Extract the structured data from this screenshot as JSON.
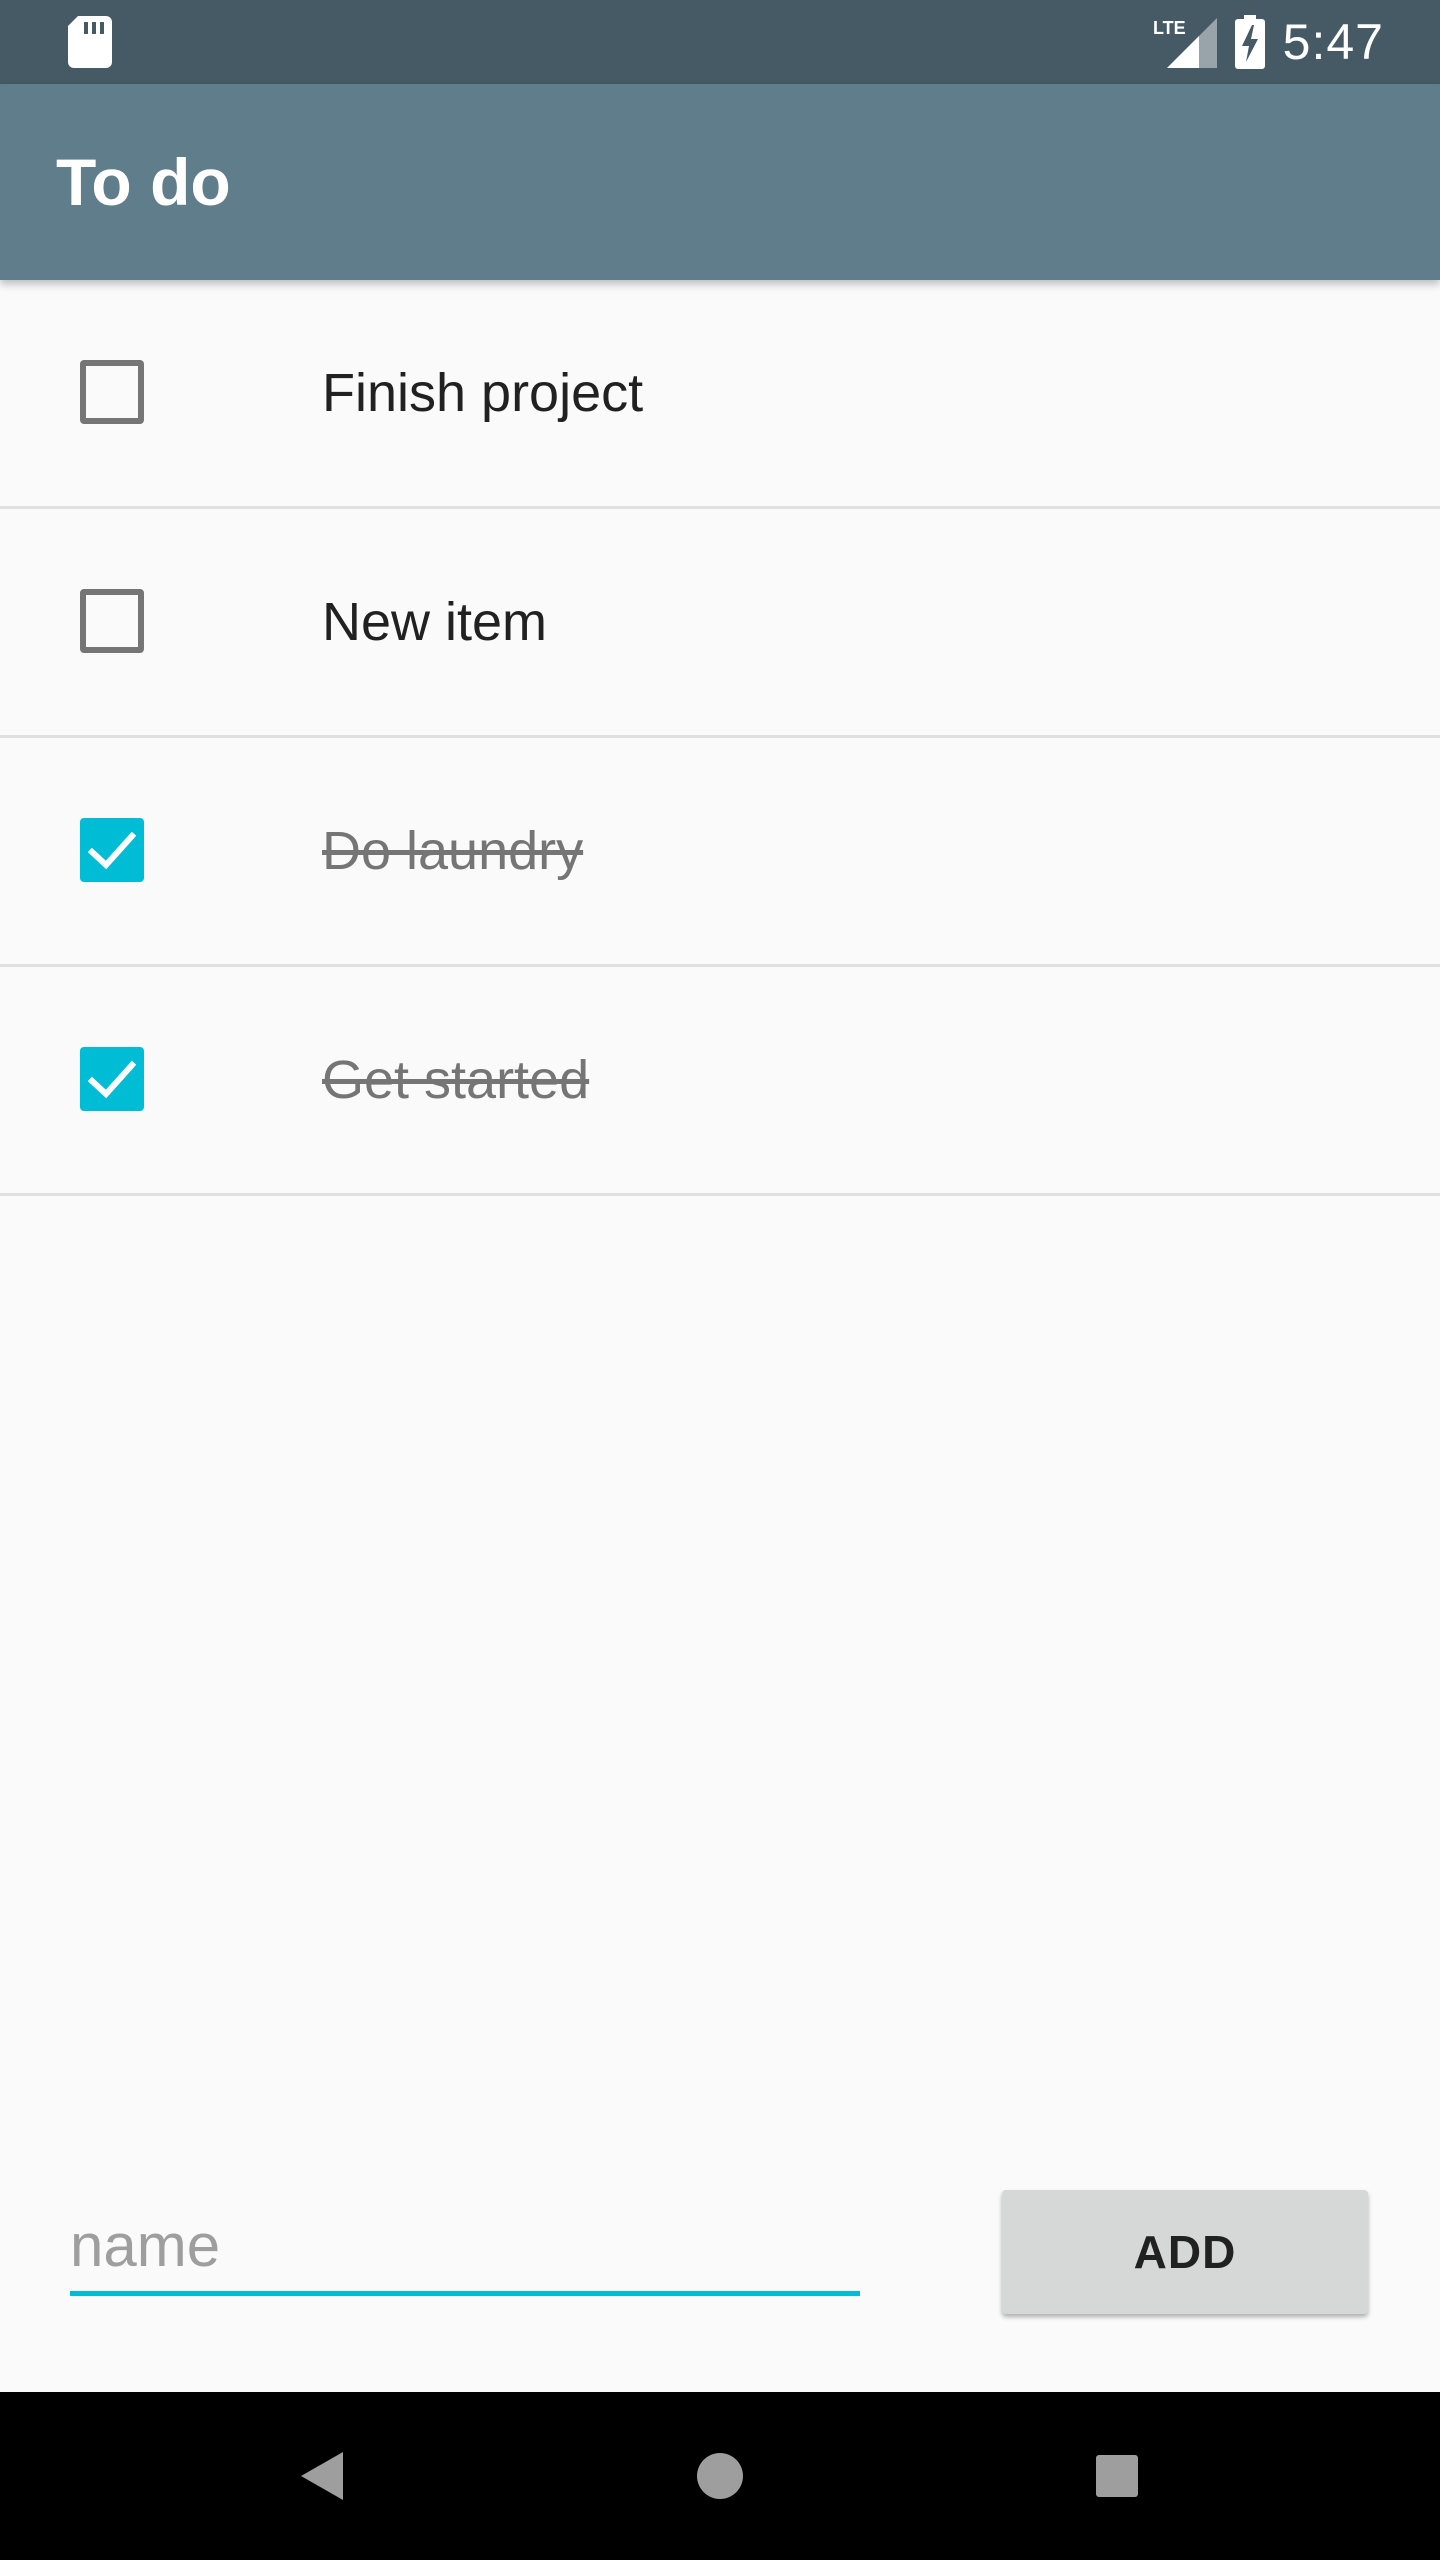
{
  "status_bar": {
    "time": "5:47",
    "network": "LTE",
    "icons": [
      "sd-card-icon",
      "lte-signal-icon",
      "battery-charging-icon"
    ]
  },
  "app_bar": {
    "title": "To do"
  },
  "todos": [
    {
      "label": "Finish project",
      "checked": false
    },
    {
      "label": "New item",
      "checked": false
    },
    {
      "label": "Do laundry",
      "checked": true
    },
    {
      "label": "Get started",
      "checked": true
    }
  ],
  "new_item": {
    "placeholder": "name",
    "value": ""
  },
  "add_button": {
    "label": "ADD"
  },
  "nav_bar": {
    "icons": [
      "back-icon",
      "home-icon",
      "recents-icon"
    ]
  },
  "colors": {
    "status_bar": "#455a64",
    "app_bar": "#607d8b",
    "accent": "#00bcd4",
    "background": "#fafafa"
  }
}
